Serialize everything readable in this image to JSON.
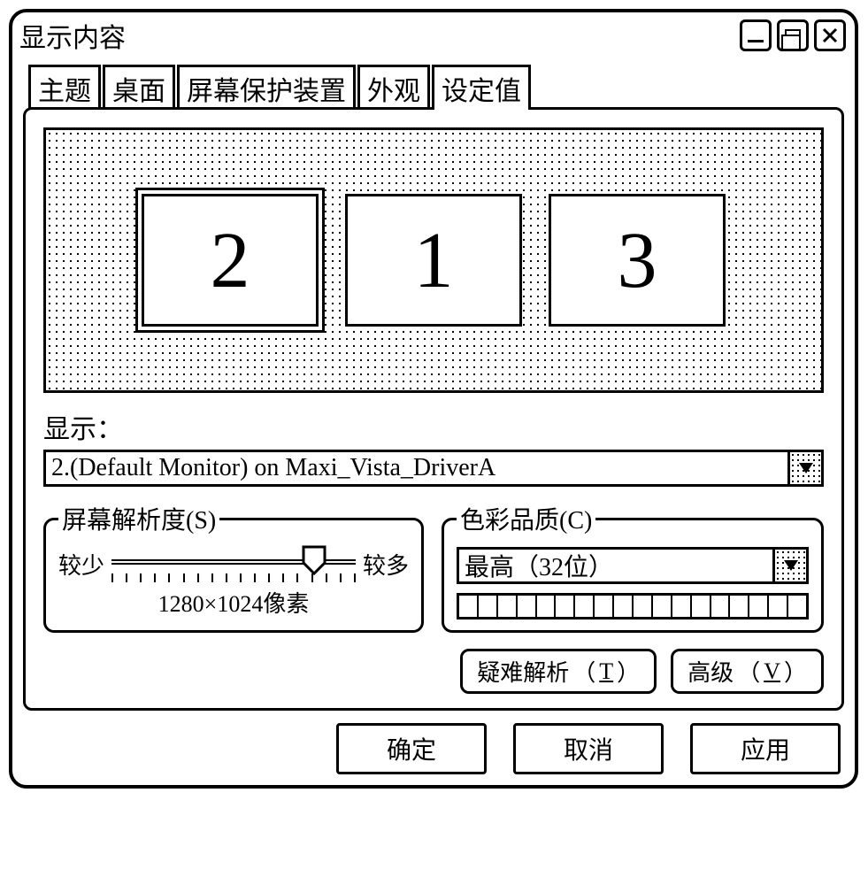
{
  "window": {
    "title": "显示内容"
  },
  "tabs": {
    "items": [
      "主题",
      "桌面",
      "屏幕保护装置",
      "外观",
      "设定值"
    ],
    "active_index": 4
  },
  "monitors": {
    "items": [
      "2",
      "1",
      "3"
    ],
    "selected_index": 0
  },
  "display_label": "显示：",
  "display_dropdown": {
    "selected": "2.(Default Monitor) on Maxi_Vista_DriverA"
  },
  "resolution": {
    "legend": "屏幕解析度(S)",
    "less": "较少",
    "more": "较多",
    "value": "1280×1024像素"
  },
  "color_quality": {
    "legend": "色彩品质(C)",
    "selected": "最高（32位）"
  },
  "sub_buttons": {
    "troubleshoot": "疑难解析",
    "troubleshoot_key": "T",
    "advanced": "高级",
    "advanced_key": "V"
  },
  "bottom_buttons": {
    "ok": "确定",
    "cancel": "取消",
    "apply": "应用"
  }
}
